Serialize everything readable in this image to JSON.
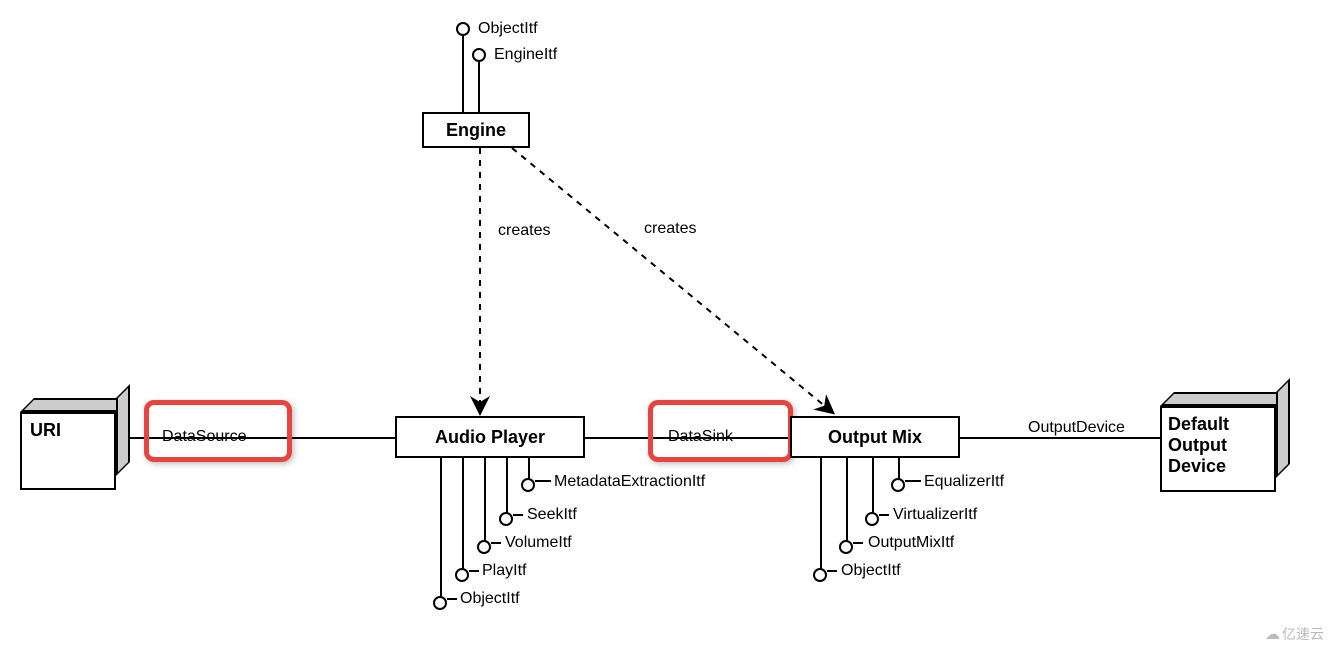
{
  "engine": {
    "label": "Engine",
    "interfaces": [
      "ObjectItf",
      "EngineItf"
    ]
  },
  "uri": {
    "label": "URI"
  },
  "defaultDevice": {
    "label": "Default\nOutput\nDevice"
  },
  "audioPlayer": {
    "label": "Audio Player",
    "interfaces": [
      "MetadataExtractionItf",
      "SeekItf",
      "VolumeItf",
      "PlayItf",
      "ObjectItf"
    ]
  },
  "outputMix": {
    "label": "Output Mix",
    "interfaces": [
      "EqualizerItf",
      "VirtualizerItf",
      "OutputMixItf",
      "ObjectItf"
    ]
  },
  "edges": {
    "dataSource": "DataSource",
    "dataSink": "DataSink",
    "outputDevice": "OutputDevice",
    "creates": "creates"
  },
  "watermark": "亿速云"
}
